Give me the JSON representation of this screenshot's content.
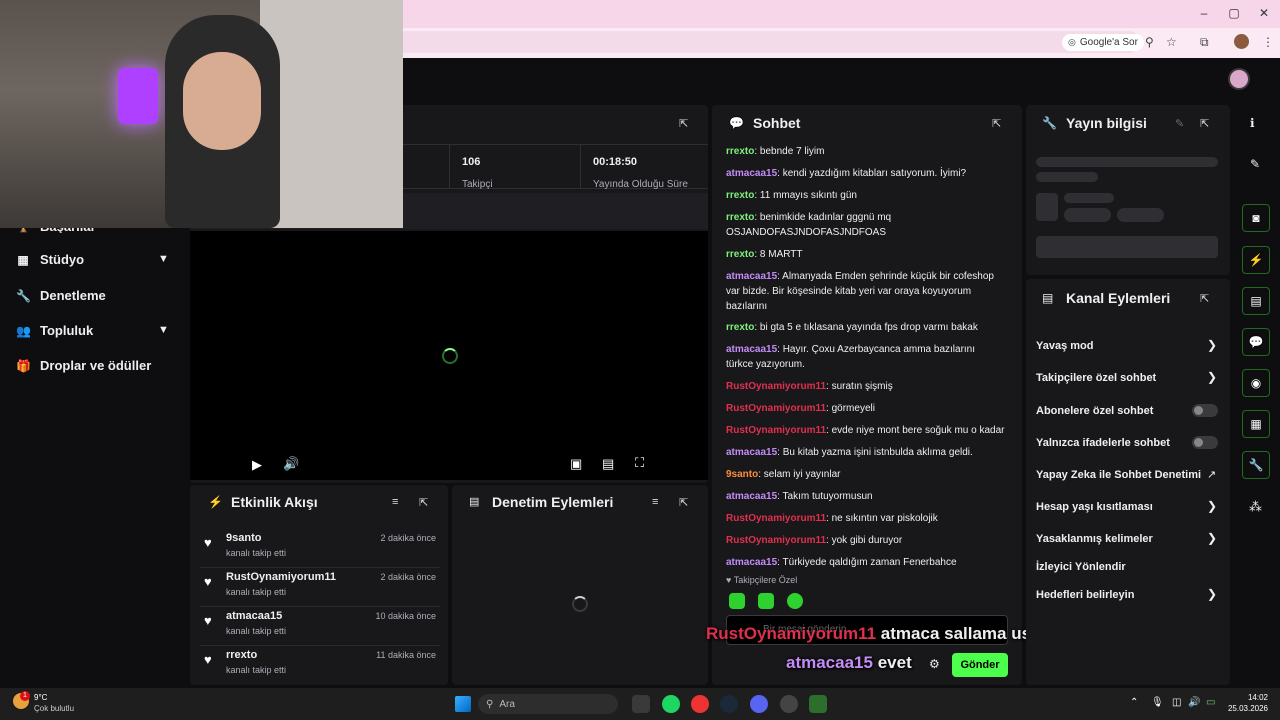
{
  "browser": {
    "minimize": "–",
    "maximize": "▢",
    "close": "✕",
    "google_chip": "Google'a Sor"
  },
  "nav": {
    "partial_item": "Başarılar",
    "items": [
      {
        "label": "Stüdyo",
        "icon": "film-icon",
        "expandable": true
      },
      {
        "label": "Denetleme",
        "icon": "wrench-icon",
        "expandable": false
      },
      {
        "label": "Topluluk",
        "icon": "people-icon",
        "expandable": true
      },
      {
        "label": "Droplar ve ödüller",
        "icon": "gift-icon",
        "expandable": false
      }
    ]
  },
  "stats": {
    "followers_value": "106",
    "followers_label": "Takipçi",
    "uptime_value": "00:18:50",
    "uptime_label": "Yayında Olduğu Süre"
  },
  "activity": {
    "title": "Etkinlik Akışı",
    "items": [
      {
        "name": "9santo",
        "sub": "kanalı takip etti",
        "time": "2 dakika önce"
      },
      {
        "name": "RustOynamiyorum11",
        "sub": "kanalı takip etti",
        "time": "2 dakika önce"
      },
      {
        "name": "atmacaa15",
        "sub": "kanalı takip etti",
        "time": "10 dakika önce"
      },
      {
        "name": "rrexto",
        "sub": "kanalı takip etti",
        "time": "11 dakika önce"
      }
    ]
  },
  "moderation": {
    "title": "Denetim Eylemleri"
  },
  "chat": {
    "title": "Sohbet",
    "messages": [
      {
        "user": "rrexto",
        "color": "green",
        "text": ": bebnde 7 liyim"
      },
      {
        "user": "atmacaa15",
        "color": "purple",
        "text": ": kendi yazdığım kitabları satıyorum. İyimi?"
      },
      {
        "user": "rrexto",
        "color": "green",
        "text": ": 11 mmayıs sıkıntı gün"
      },
      {
        "user": "rrexto",
        "color": "green",
        "text": ": benimkide kadınlar gggnü mq OSJANDOFASJNDOFASJNDFOAS"
      },
      {
        "user": "rrexto",
        "color": "green",
        "text": ": 8 MARTT"
      },
      {
        "user": "atmacaa15",
        "color": "purple",
        "text": ": Almanyada Emden şehrinde küçük bir cofeshop var bizde. Bir köşesinde kitab yeri var oraya koyuyorum bazılarını"
      },
      {
        "user": "rrexto",
        "color": "green",
        "text": ": bi gta 5 e tıklasana yayında fps drop varmı bakak"
      },
      {
        "user": "atmacaa15",
        "color": "purple",
        "text": ": Hayır. Çoxu Azerbaycanca amma bazılarını türkce yazıyorum."
      },
      {
        "user": "RustOynamiyorum11",
        "color": "red",
        "text": ": suratın şişmiş"
      },
      {
        "user": "RustOynamiyorum11",
        "color": "red",
        "text": ": görmeyeli"
      },
      {
        "user": "RustOynamiyorum11",
        "color": "red",
        "text": ": evde niye mont bere soğuk mu o kadar"
      },
      {
        "user": "atmacaa15",
        "color": "purple",
        "text": ": Bu kitab yazma işini istnbulda aklıma geldi."
      },
      {
        "user": "9santo",
        "color": "orange",
        "text": ": selam iyi yayınlar"
      },
      {
        "user": "atmacaa15",
        "color": "purple",
        "text": ": Takım tutuyormusun"
      },
      {
        "user": "RustOynamiyorum11",
        "color": "red",
        "text": ": ne sıkıntın var piskolojik"
      },
      {
        "user": "RustOynamiyorum11",
        "color": "red",
        "text": ": yok gibi duruyor"
      },
      {
        "user": "atmacaa15",
        "color": "purple",
        "text": ": Türkiyede qaldığım zaman Fenerbahce"
      }
    ],
    "followers_only": "Takipçilere Özel",
    "input_placeholder": "Bir mesaj gönderin",
    "send_label": "Gönder",
    "overlay": [
      {
        "user": "RustOynamiyorum11",
        "text": "atmaca sallama usta ya"
      },
      {
        "user": "atmacaa15",
        "text": "evet"
      }
    ]
  },
  "stream_info": {
    "title": "Yayın bilgisi"
  },
  "channel_actions": {
    "title": "Kanal Eylemleri",
    "items": [
      {
        "label": "Yavaş mod",
        "kind": "arrow"
      },
      {
        "label": "Takipçilere özel sohbet",
        "kind": "arrow"
      },
      {
        "label": "Abonelere özel sohbet",
        "kind": "toggle"
      },
      {
        "label": "Yalnızca ifadelerle sohbet",
        "kind": "toggle"
      },
      {
        "label": "Yapay Zeka ile Sohbet Denetimi",
        "kind": "external"
      },
      {
        "label": "Hesap yaşı kısıtlaması",
        "kind": "arrow"
      },
      {
        "label": "Yasaklanmış kelimeler",
        "kind": "arrow"
      },
      {
        "label": "İzleyici Yönlendir",
        "kind": "none"
      },
      {
        "label": "Hedefleri belirleyin",
        "kind": "arrow"
      }
    ]
  },
  "taskbar": {
    "weather_temp": "9°C",
    "weather_desc": "Çok bulutlu",
    "weather_badge": "1",
    "search_label": "Ara",
    "time": "14:02",
    "date": "25.03.2026"
  }
}
